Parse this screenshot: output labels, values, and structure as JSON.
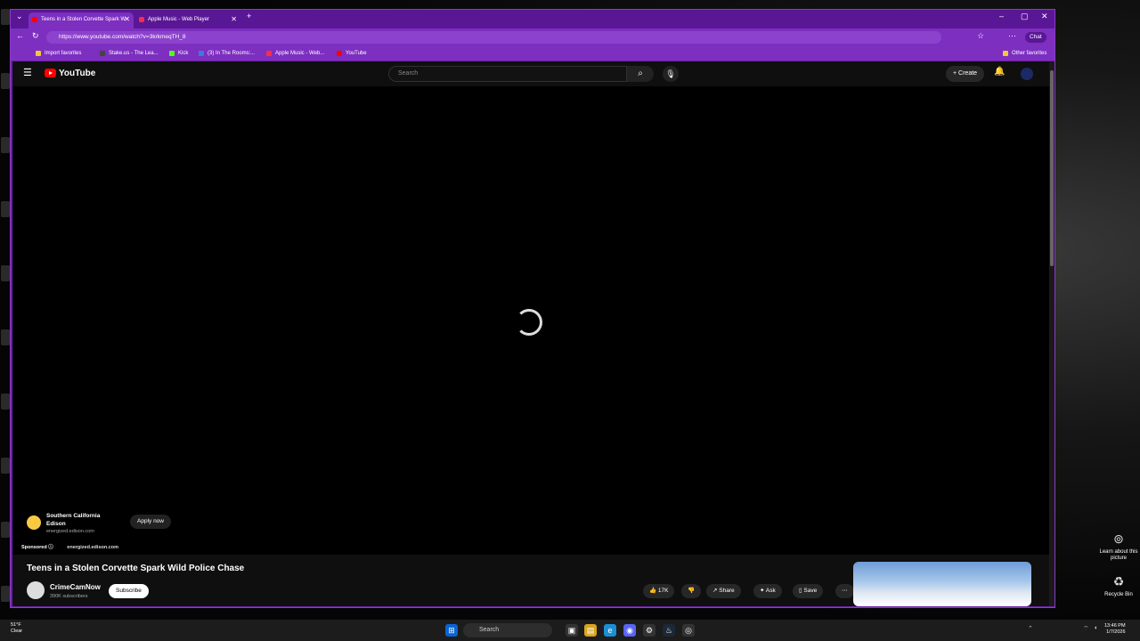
{
  "desktop": {
    "right_icons": [
      {
        "label": "Learn about this picture",
        "icon": "info-icon"
      },
      {
        "label": "Recycle Bin",
        "icon": "recycle-bin-icon"
      }
    ]
  },
  "browser": {
    "tabs": [
      {
        "title": "Teens in a Stolen Corvette Spark W",
        "active": true
      },
      {
        "title": "Apple Music - Web Player",
        "active": false
      }
    ],
    "url": "https://www.youtube.com/watch?v=3krkmeqTH_8",
    "chat_label": "Chat",
    "bookmarks": [
      {
        "label": "Import favorites",
        "color": "#f5c542"
      },
      {
        "label": "Stake.us - The Lea...",
        "color": "#444444"
      },
      {
        "label": "Kick",
        "color": "#53fc18"
      },
      {
        "label": "(3) In The Rooms:...",
        "color": "#3a7bd5"
      },
      {
        "label": "Apple Music - Web...",
        "color": "#fa2d48"
      },
      {
        "label": "YouTube",
        "color": "#ff0000"
      }
    ],
    "other_favorites": "Other favorites"
  },
  "youtube": {
    "logo_text": "YouTube",
    "search_placeholder": "Search",
    "create_label": "Create",
    "ad": {
      "advertiser": "Southern California Edison",
      "domain": "energized.edison.com",
      "apply_label": "Apply now",
      "sponsored_label": "Sponsored",
      "sponsored_domain": "energized.edison.com"
    },
    "video": {
      "title": "Teens in a Stolen Corvette Spark Wild Police Chase",
      "channel": "CrimeCamNow",
      "subscribers": "390K subscribers",
      "subscribe_label": "Subscribe",
      "likes": "17K",
      "share_label": "Share",
      "ask_label": "Ask",
      "save_label": "Save"
    }
  },
  "taskbar": {
    "weather_temp": "51°F",
    "weather_cond": "Clear",
    "search_label": "Search",
    "time": "13:46 PM",
    "date": "1/7/2026"
  }
}
